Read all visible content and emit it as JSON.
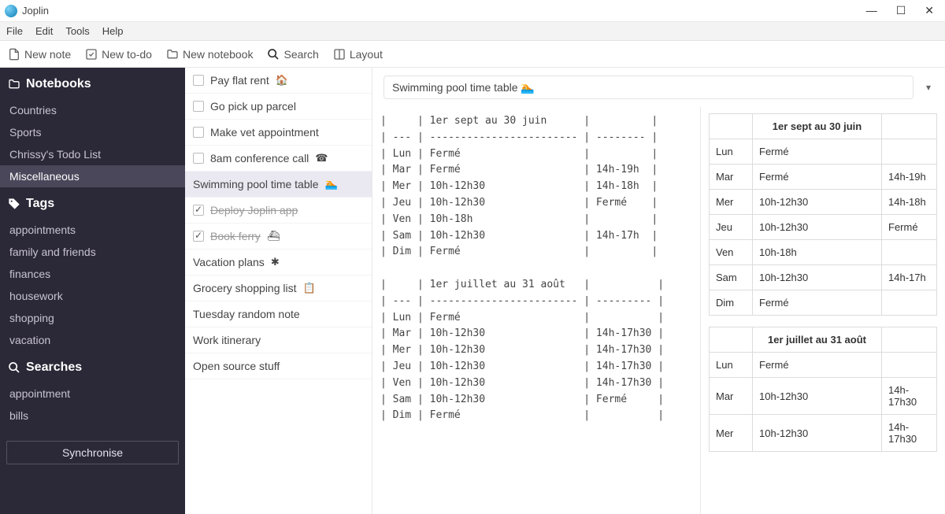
{
  "window": {
    "title": "Joplin"
  },
  "menubar": [
    "File",
    "Edit",
    "Tools",
    "Help"
  ],
  "toolbar": {
    "new_note": "New note",
    "new_todo": "New to-do",
    "new_notebook": "New notebook",
    "search": "Search",
    "layout": "Layout"
  },
  "sidebar": {
    "notebooks_title": "Notebooks",
    "notebooks": [
      "Countries",
      "Sports",
      "Chrissy's Todo List",
      "Miscellaneous"
    ],
    "selected_notebook_index": 3,
    "tags_title": "Tags",
    "tags": [
      "appointments",
      "family and friends",
      "finances",
      "housework",
      "shopping",
      "vacation"
    ],
    "searches_title": "Searches",
    "searches": [
      "appointment",
      "bills"
    ],
    "sync_label": "Synchronise"
  },
  "notelist": {
    "items": [
      {
        "label": "Pay flat rent",
        "emoji": "🏠",
        "checkbox": true,
        "checked": false
      },
      {
        "label": "Go pick up parcel",
        "emoji": "",
        "checkbox": true,
        "checked": false
      },
      {
        "label": "Make vet appointment",
        "emoji": "",
        "checkbox": true,
        "checked": false
      },
      {
        "label": "8am conference call",
        "emoji": "☎",
        "checkbox": true,
        "checked": false
      },
      {
        "label": "Swimming pool time table",
        "emoji": "🏊",
        "checkbox": false,
        "checked": false,
        "selected": true
      },
      {
        "label": "Deploy Joplin app",
        "emoji": "",
        "checkbox": true,
        "checked": true
      },
      {
        "label": "Book ferry",
        "emoji": "⛴",
        "checkbox": true,
        "checked": true
      },
      {
        "label": "Vacation plans",
        "emoji": "✱",
        "checkbox": false,
        "checked": false
      },
      {
        "label": "Grocery shopping list",
        "emoji": "📋",
        "checkbox": false,
        "checked": false
      },
      {
        "label": "Tuesday random note",
        "emoji": "",
        "checkbox": false,
        "checked": false
      },
      {
        "label": "Work itinerary",
        "emoji": "",
        "checkbox": false,
        "checked": false
      },
      {
        "label": "Open source stuff",
        "emoji": "",
        "checkbox": false,
        "checked": false
      }
    ]
  },
  "editor": {
    "title": "Swimming pool time table 🏊",
    "markdown": "|     | 1er sept au 30 juin      |          |\n| --- | ------------------------ | -------- |\n| Lun | Fermé                    |          |\n| Mar | Fermé                    | 14h-19h  |\n| Mer | 10h-12h30                | 14h-18h  |\n| Jeu | 10h-12h30                | Fermé    |\n| Ven | 10h-18h                  |          |\n| Sam | 10h-12h30                | 14h-17h  |\n| Dim | Fermé                    |          |\n\n|     | 1er juillet au 31 août   |           |\n| --- | ------------------------ | --------- |\n| Lun | Fermé                    |           |\n| Mar | 10h-12h30                | 14h-17h30 |\n| Mer | 10h-12h30                | 14h-17h30 |\n| Jeu | 10h-12h30                | 14h-17h30 |\n| Ven | 10h-12h30                | 14h-17h30 |\n| Sam | 10h-12h30                | Fermé     |\n| Dim | Fermé                    |           |"
  },
  "rendered": {
    "tables": [
      {
        "title": "1er sept au 30 juin",
        "rows": [
          [
            "Lun",
            "Fermé",
            ""
          ],
          [
            "Mar",
            "Fermé",
            "14h-19h"
          ],
          [
            "Mer",
            "10h-12h30",
            "14h-18h"
          ],
          [
            "Jeu",
            "10h-12h30",
            "Fermé"
          ],
          [
            "Ven",
            "10h-18h",
            ""
          ],
          [
            "Sam",
            "10h-12h30",
            "14h-17h"
          ],
          [
            "Dim",
            "Fermé",
            ""
          ]
        ]
      },
      {
        "title": "1er juillet au 31 août",
        "rows": [
          [
            "Lun",
            "Fermé",
            ""
          ],
          [
            "Mar",
            "10h-12h30",
            "14h-17h30"
          ],
          [
            "Mer",
            "10h-12h30",
            "14h-17h30"
          ]
        ]
      }
    ]
  }
}
